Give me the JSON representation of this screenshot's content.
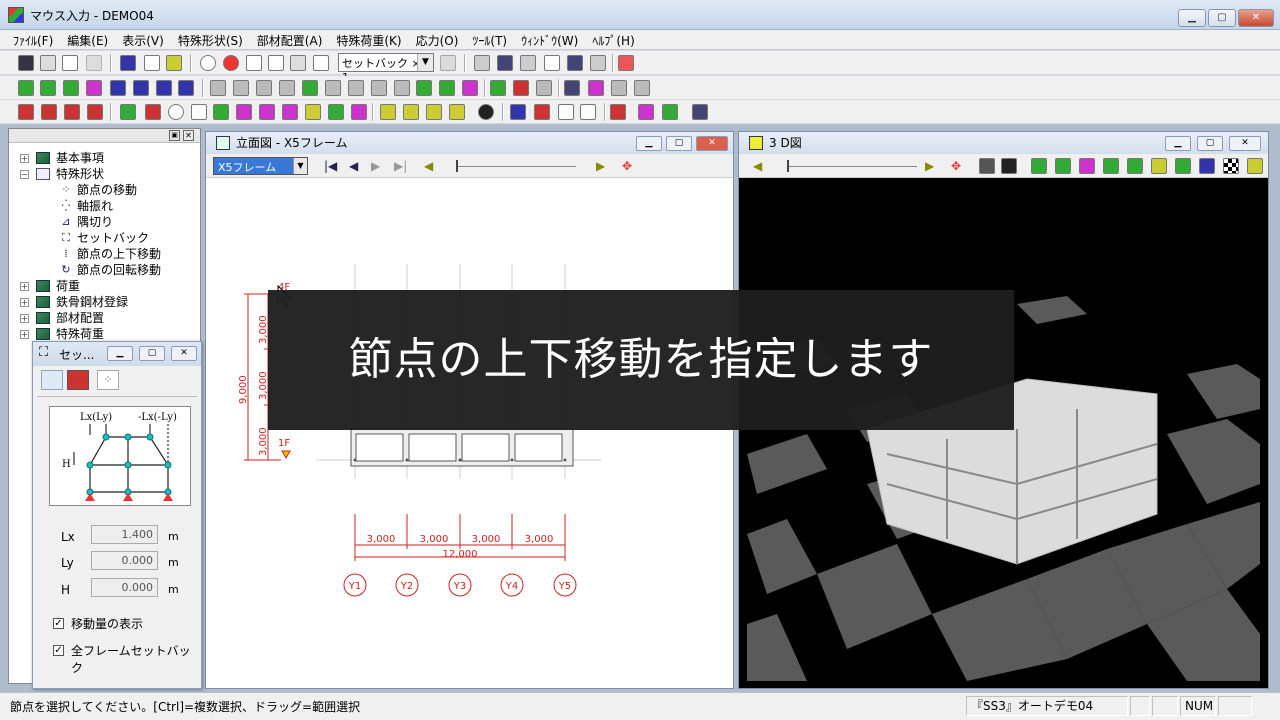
{
  "window": {
    "title": "マウス入力 - DEMO04",
    "min_icon": "minimize-icon",
    "max_icon": "maximize-icon",
    "close_icon": "close-icon"
  },
  "menu": [
    "ﾌｧｲﾙ(F)",
    "編集(E)",
    "表示(V)",
    "特殊形状(S)",
    "部材配置(A)",
    "特殊荷重(K)",
    "応力(O)",
    "ﾂｰﾙ(T)",
    "ｳｨﾝﾄﾞｳ(W)",
    "ﾍﾙﾌﾟ(H)"
  ],
  "toolbar": {
    "setback_select": "セットバック × 1",
    "dropdown_arrow": "▼"
  },
  "tree": {
    "items": [
      {
        "label": "基本事項",
        "exp": "+"
      },
      {
        "label": "特殊形状",
        "exp": "−"
      },
      {
        "label": "節点の移動"
      },
      {
        "label": "軸振れ"
      },
      {
        "label": "隅切り"
      },
      {
        "label": "セットバック"
      },
      {
        "label": "節点の上下移動"
      },
      {
        "label": "節点の回転移動"
      },
      {
        "label": "荷重",
        "exp": "+"
      },
      {
        "label": "鉄骨鋼材登録",
        "exp": "+"
      },
      {
        "label": "部材配置",
        "exp": "+"
      },
      {
        "label": "特殊荷重",
        "exp": "+"
      }
    ]
  },
  "setback_window": {
    "title": "セッ...",
    "diagram": {
      "lx_label": "Lx(Ly)",
      "neg_lx_label": "-Lx(-Ly)",
      "h_label": "H"
    },
    "params": [
      {
        "label": "Lx",
        "value": "1.400",
        "unit": "m"
      },
      {
        "label": "Ly",
        "value": "0.000",
        "unit": "m"
      },
      {
        "label": "H",
        "value": "0.000",
        "unit": "m"
      }
    ],
    "checkboxes": [
      {
        "label": "移動量の表示",
        "checked": "✓"
      },
      {
        "label": "全フレームセットバック",
        "checked": "✓"
      }
    ]
  },
  "elevation": {
    "title": "立面図 - X5フレーム",
    "frame_select": "X5フレーム",
    "floors": [
      "4F",
      "1F"
    ],
    "story_dims": [
      "3,000",
      "3,000",
      "3,000"
    ],
    "total_height": "9,000",
    "span_dims": [
      "3,000",
      "3,000",
      "3,000",
      "3,000"
    ],
    "total_span": "12,000",
    "grid_labels": [
      "Y1",
      "Y2",
      "Y3",
      "Y4",
      "Y5"
    ],
    "accent_color": "#cc2222"
  },
  "view3d": {
    "title": "3 D図"
  },
  "caption": "節点の上下移動を指定します",
  "status": {
    "message": "節点を選択してください。[Ctrl]=複数選択、ドラッグ=範囲選択",
    "file": "『SS3』オートデモ04",
    "num": "NUM"
  }
}
